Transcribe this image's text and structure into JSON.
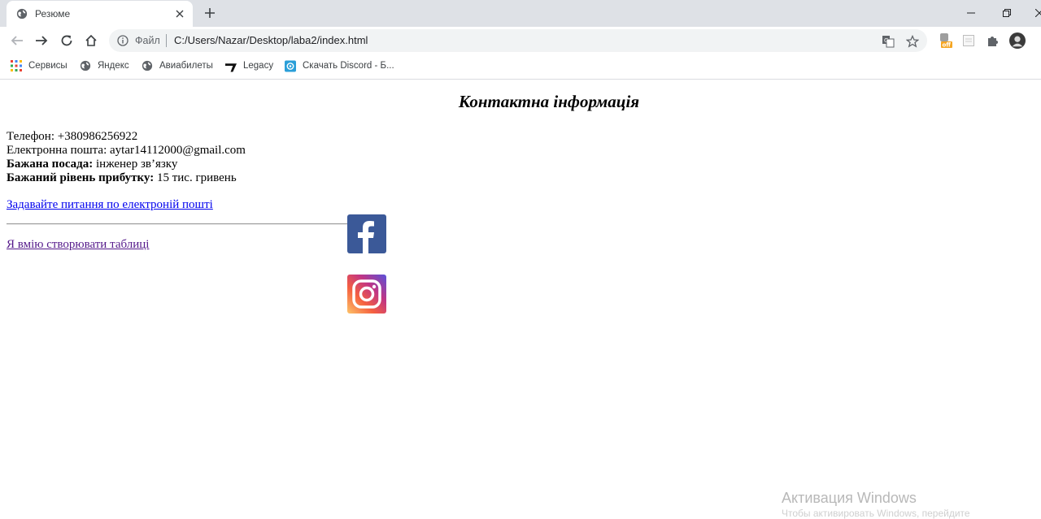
{
  "browser": {
    "tab": {
      "title": "Резюме"
    },
    "address": {
      "file_label": "Файл",
      "url": "C:/Users/Nazar/Desktop/laba2/index.html"
    },
    "extension_badge": "off",
    "bookmarks": [
      {
        "label": "Сервисы",
        "icon": "apps-grid-icon"
      },
      {
        "label": "Яндекс",
        "icon": "globe-icon"
      },
      {
        "label": "Авиабилеты",
        "icon": "globe-icon"
      },
      {
        "label": "Legacy",
        "icon": "legacy-logo-icon"
      },
      {
        "label": "Скачать Discord - Б...",
        "icon": "discord-download-icon"
      }
    ]
  },
  "page": {
    "heading": "Контактна інформація",
    "phone": {
      "label": "Телефон:",
      "value": "+380986256922"
    },
    "email": {
      "label": "Електронна пошта:",
      "value": "aytar14112000@gmail.com"
    },
    "position": {
      "label": "Бажана посада:",
      "value": "інженер зв’язку"
    },
    "salary": {
      "label": "Бажаний рівень прибутку:",
      "value": "15 тис. гривень"
    },
    "mail_link": "Задавайте питання по електроній пошті",
    "tables_link": "Я вмію створювати таблиці",
    "social": [
      {
        "name": "facebook",
        "color": "#3b5998"
      },
      {
        "name": "instagram",
        "color": "#c13584"
      }
    ]
  },
  "watermark": {
    "title": "Активация Windows",
    "subtitle": "Чтобы активировать Windows, перейдите"
  }
}
